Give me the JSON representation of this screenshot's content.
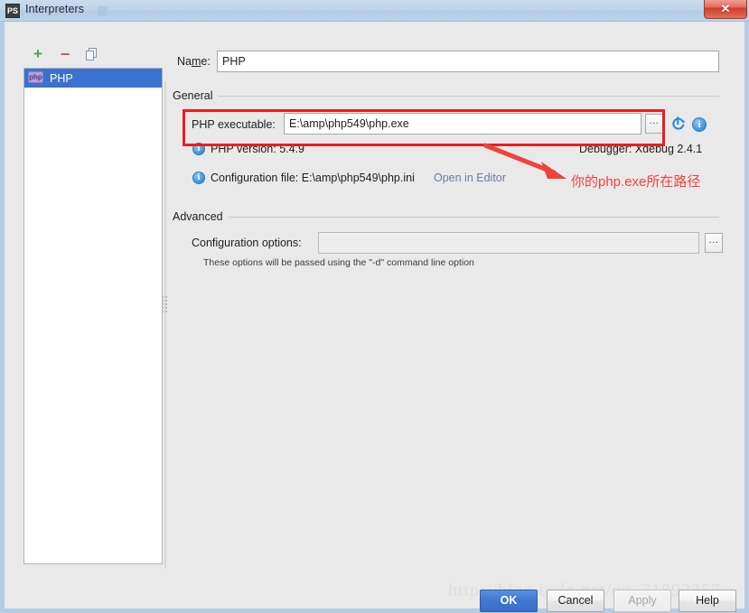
{
  "window": {
    "title": "Interpreters",
    "icon": "phpstorm-icon",
    "icon_text": "PS",
    "close_label": "✕"
  },
  "toolbar": {
    "add_label": "+",
    "remove_label": "−",
    "copy_label": "copy-icon"
  },
  "list": {
    "items": [
      {
        "label": "PHP",
        "badge": "php",
        "selected": true
      }
    ]
  },
  "form": {
    "name_label_pre": "Na",
    "name_label_mn": "m",
    "name_label_post": "e:",
    "name_value": "PHP",
    "general_section": "General",
    "php_executable_label": "PHP executable:",
    "php_executable_value": "E:\\amp\\php549\\php.exe",
    "browse_label": "...",
    "refresh_label": "refresh-icon",
    "info_label": "i",
    "php_version_text": "PHP version: 5.4.9",
    "debugger_text": "Debugger: Xdebug 2.4.1",
    "config_file_text": "Configuration file: E:\\amp\\php549\\php.ini",
    "open_in_editor_label": "Open in Editor",
    "advanced_section": "Advanced",
    "config_options_label": "Configuration options:",
    "config_options_value": "",
    "config_options_browse": "...",
    "config_options_hint": "These options will be passed using the \"-d\" command line option"
  },
  "annotations": {
    "highlight_color": "#ef1c1c",
    "note_text": "你的php.exe所在路径",
    "watermark": "http://blog.csdn.net/qq_31893357"
  },
  "buttons": {
    "ok": "OK",
    "cancel": "Cancel",
    "apply": "Apply",
    "help": "Help"
  }
}
